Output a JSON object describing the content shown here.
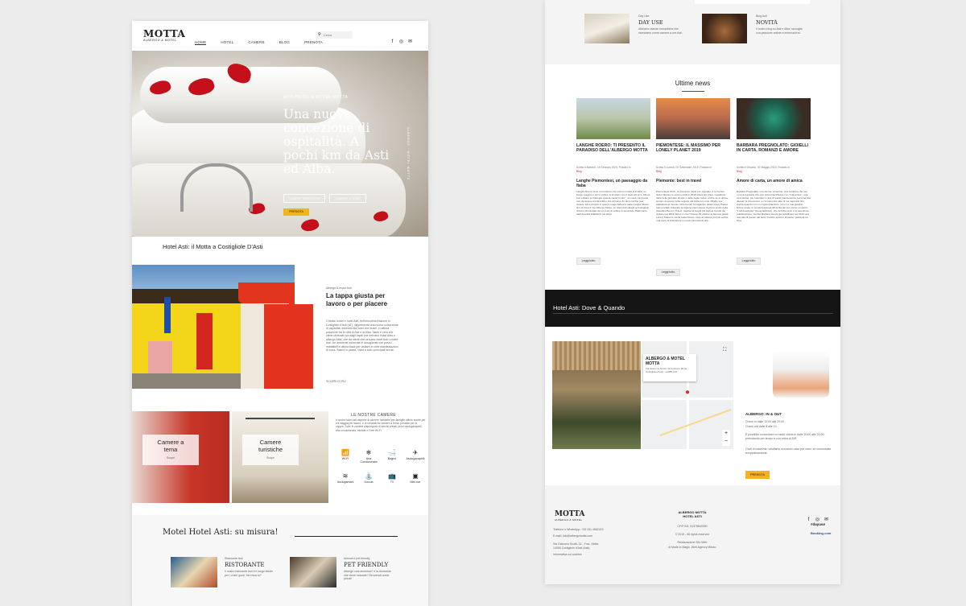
{
  "left": {
    "logo": {
      "name": "MOTTA",
      "sub": "ALBERGO & MOTEL"
    },
    "nav": [
      "HOME",
      "HOTEL",
      "CAMERE",
      "BLOG",
      "PRENOTA"
    ],
    "search_placeholder": "Cerca",
    "social": [
      "f",
      "◎",
      "✉"
    ],
    "hero": {
      "kicker": "ASTI HOTEL & MOTEL MOTTA",
      "title": "Una nuova concezione di ospitalità. A pochi km da Asti ed Alba.",
      "btn1": "CAMERE TURISTICHE",
      "btn2": "CAMERE A TEMA",
      "btn3": "PRENOTA",
      "vertical": "ALBERGO · MOTEL MOTTA"
    },
    "section_title": "Hotel Asti: il Motta a Costigliole D'Asti",
    "about": {
      "kicker": "Albergo & motel Asti",
      "title": "La tappa giusta per lavoro o per piacere",
      "text": "Il Motta, motel e hotel Asti, nell'omonima frazione in Costigliole d'Asti (AT), rappresenta una nuova concezione di ospitalità, essendo sia hotel che motel, in ottima posizione tra le città di Asti e di Alba. Tanto è vero che viene utilizzato sia dagli ospiti che cercano Hotel Alba o albergo Alba, che da utenti che cercano hotel Asti o motel Asti. Un ambiente informale e accogliente con prezzi imbattibili e ottima base per visitare le note manifestazioni di zona. Siamo in paese, vicini a tutti i principali servizi.",
      "more": "SCOPRI DI PIÙ"
    },
    "rooms": {
      "kicker": "LE NOSTRE CAMERE",
      "theme": "Camere a tema",
      "theme_link": "Scopri",
      "tour": "Camere turistiche",
      "tour_link": "Scopri",
      "text": "Il nostro hotel Asti dispone di camere turistiche per famiglie ottime anche per chi viaggia per lavoro, e di romantiche camere a tema, pensate per le coppie. Tutte le camere dispongono di servizi privati, phon asciugacapelli, aria condizionata, minibar e Free Wi-Fi.",
      "amenities": [
        {
          "icon": "wifi-icon",
          "glyph": "📶",
          "label": "Wi-Fi"
        },
        {
          "icon": "air-conditioning-icon",
          "glyph": "❄",
          "label": "Aria Condizionata"
        },
        {
          "icon": "bath-icon",
          "glyph": "🛁",
          "label": "Bagno"
        },
        {
          "icon": "hairdryer-icon",
          "glyph": "✈",
          "label": "Asciugacapelli"
        },
        {
          "icon": "towels-icon",
          "glyph": "≋",
          "label": "Asciugamani"
        },
        {
          "icon": "shower-icon",
          "glyph": "⛲",
          "label": "Doccia"
        },
        {
          "icon": "tv-icon",
          "glyph": "📺",
          "label": "TV"
        },
        {
          "icon": "minibar-icon",
          "glyph": "▣",
          "label": "Mini-bar"
        }
      ]
    },
    "motel_title": "Motel Hotel Asti: su misura!",
    "bottom": [
      {
        "kicker": "Ristorante Asti",
        "title": "RISTORANTE",
        "text": "Il nostro ristorante Asti è il luogo ideale per i vostri gusti. Sei mica tu?"
      },
      {
        "kicker": "Animali e pet friendly",
        "title": "PET FRIENDLY",
        "text": "Albergo cani ammessi? è la domanda che viene naturale? Benvenuti amici pelosi!"
      }
    ]
  },
  "right": {
    "top": [
      {
        "kicker": "Day Use",
        "title": "DAY USE",
        "text": "Abbiamo stanze romantiche che riserviamo come camere a ore Asti."
      },
      {
        "kicker": "Blog Asti",
        "title": "NOVITÀ",
        "text": "Il nostro blog su Asti e Alba: raccoglie con passione notizie e informazioni."
      }
    ],
    "news_title": "Ultime news",
    "news": [
      {
        "title": "LANGHE ROERO: TI PRESENTO IL PARADISO DELL'ALBERGO MOTTA",
        "meta": "Scritto il Martedì, 14 Gennaio 2020. Postato in",
        "cat": "Blog",
        "sub": "Langhe Piemontesi, un paesaggio da fiaba",
        "text": "Langhe Roero sono un territorio che tutto il mondo ci invidia, un borgo magico in cui le colline si fondono con il cielo azzurro. Alcuni non esitano a chiamare questa vasta \"moire\", un mare composito non da acqua ma da colline che arrivano fin dove occhio può vedere. Ed è proprio in questo luogo fiabesco delle Langhe Roero che si trova il mio Albergo Motta, un hotel Asti situato a Costigliole d'Asti e circondato da un mare di colline riconosciute Patrimonio dell'Umanità UNESCO nel 2014.",
        "btn": "Leggi tutto"
      },
      {
        "title": "PIEMONTESE: IL MASSIMO PER LONELY PLANET 2019",
        "meta": "Scritto il Lunedì, 02 Settembre 2019. Postato in",
        "cat": "Blog",
        "sub": "Piemonte: best in travel",
        "text": "Piemontese DOC, mi presento ospiti con orgoglio. Il re ha ben detto! Mentre lo scorso ottobre 2018 stava per finire, regalando delle belle giornate di sole e delle foglie rosse, anche se le ultime, scopro di essere nella regione più bella non solo d'Italia, ma addirittura al mondo: il Piemonte! Il magazine della Lonely Planet hanno infatti collocato la regione piemontese al primo posto nella classifica Best in Travel, relativa ai luoghi più belli al mondo da visitare nel 2019. Ed io ci vivo! Dovevi 25 ottobre la famosa guida Lonely Planet è uscita nelle librerie, oltre al pallone proprio anche una serie di indicazioni su mete piemontesi che...",
        "btn": "Leggi tutto"
      },
      {
        "title": "BARBARA PREGNOLATO: GIOIELLI IN CARTA, ROMANZI E AMORE",
        "meta": "Scritto il Giovedì, 02 Maggio 2019. Postato in",
        "cat": "Blog",
        "sub": "Amore di carta, un amore di amica",
        "text": "Barbara Pregnolato: una donna, un'amica, una scrittrice che con un unico gioiello che non potrei identificare con \"mia amica\", una vera amica, per intenderci. Una di quelle piacevolezze persone che dieresi mi conoscono, e cui racconto tutto di me sapendo che, anche quando non ci è appropriazione, non ci è mai giudizio. Scrive quasi, in contemporanea all'uscita del suo primo romanzo \"L'altra accanto\" (Kung Edizioni), che furbizia resin e la sua prima pubblicazione, perché Barbara aveva già pubblicato nel 2013 una raccolta di poesie dal titolo \"Finché saremo di pietra\" (edizioni La Gru)...",
        "btn": "Leggi tutto"
      }
    ],
    "dark_title": "Hotel Asti: Dove & Quando",
    "map": {
      "name": "ALBERGO & MOTEL MOTTA",
      "addr": "Via Giacomo Scotti, 32 Frazione Motta Costigliole d'Asti · 14055 AST",
      "zoom_in": "+",
      "zoom_out": "−"
    },
    "checkin": {
      "title": "ALBERGO: IN & OUT",
      "lines": [
        "Check-in dalle 13:00 alle 20:00",
        "Check-out dalle 8 alle 10",
        "È possibile concordare un tardo check-in dalle 20:00 alle 22:00, prenotando per tempo e con extra di 20€.",
        "Orari di massima: valutiamo eccezioni caso per caso, se comunicate tempestivamente."
      ],
      "btn": "PRENOTA"
    },
    "footer": {
      "logo": "MOTTA",
      "logo_sub": "ALBERGO & MOTEL",
      "phone": "Telefono e WhatsApp: +39 331 4582423",
      "email": "E-mail: info@albergomotta.com",
      "addr1": "Via Giacomo Scotti, 32 - Fraz. Motta",
      "addr2": "14055 Costigliole d'Asti (Asti)",
      "privacy": "Informativa sui cookies",
      "center_title": "ALBERGO MOTTA\nHOTEL ASTI",
      "piva": "CF/P.IVA: 01378840050",
      "rights": "© 2019 - All rights reserved",
      "credit1": "Realizzazione Sito Web",
      "credit2": "di Made in Magic, Web Agency Milano",
      "dayuse": "#dayuse",
      "booking": "Booking.com"
    }
  }
}
